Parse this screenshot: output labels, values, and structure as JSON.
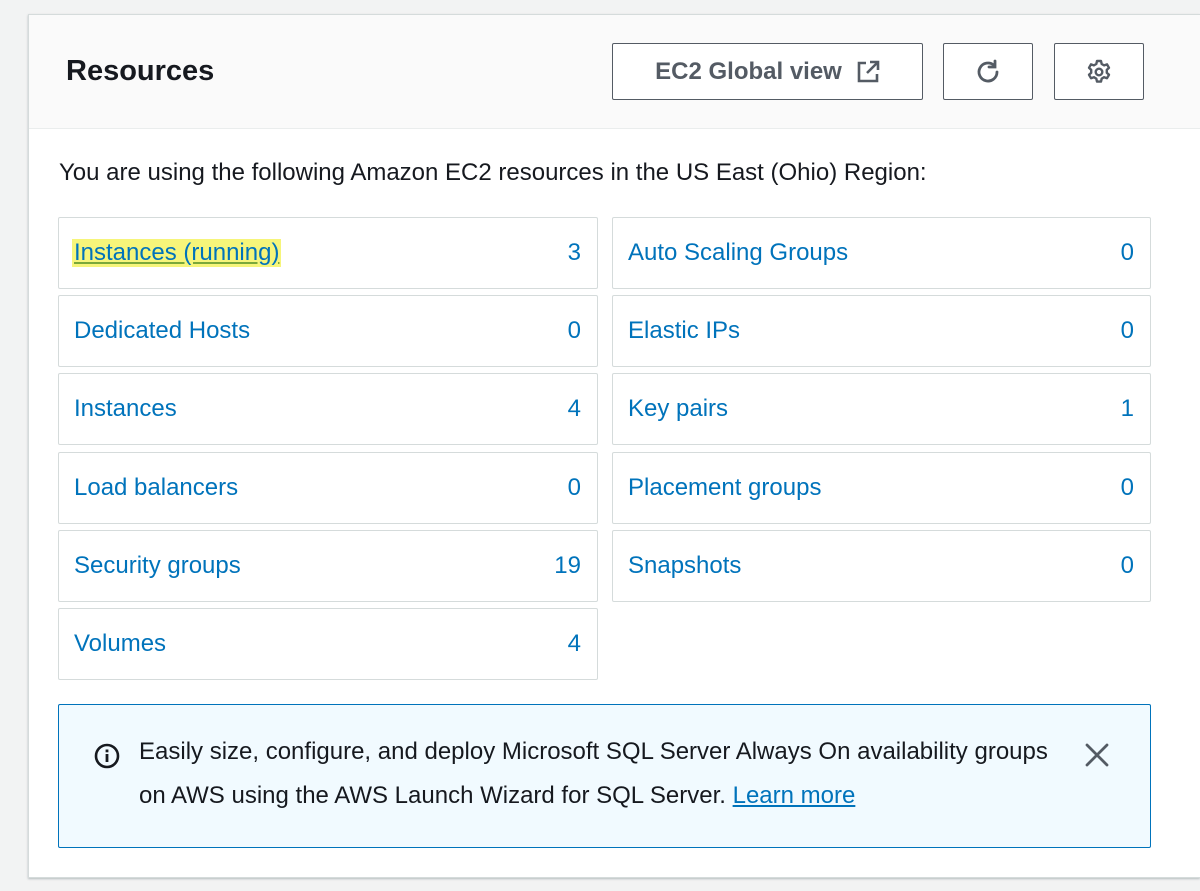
{
  "header": {
    "title": "Resources",
    "global_view_label": "EC2 Global view"
  },
  "intro_text": "You are using the following Amazon EC2 resources in the US East (Ohio) Region:",
  "resources_left": [
    {
      "label": "Instances (running)",
      "count": "3"
    },
    {
      "label": "Dedicated Hosts",
      "count": "0"
    },
    {
      "label": "Instances",
      "count": "4"
    },
    {
      "label": "Load balancers",
      "count": "0"
    },
    {
      "label": "Security groups",
      "count": "19"
    },
    {
      "label": "Volumes",
      "count": "4"
    }
  ],
  "resources_right": [
    {
      "label": "Auto Scaling Groups",
      "count": "0"
    },
    {
      "label": "Elastic IPs",
      "count": "0"
    },
    {
      "label": "Key pairs",
      "count": "1"
    },
    {
      "label": "Placement groups",
      "count": "0"
    },
    {
      "label": "Snapshots",
      "count": "0"
    }
  ],
  "alert": {
    "text": "Easily size, configure, and deploy Microsoft SQL Server Always On availability groups on AWS using the AWS Launch Wizard for SQL Server.",
    "link_label": "Learn more"
  },
  "icons": {
    "external": "external-link-icon",
    "refresh": "refresh-icon",
    "settings": "gear-icon",
    "info": "info-icon",
    "close": "close-icon"
  },
  "colors": {
    "link": "#0073bb",
    "highlight": "#f6f57a",
    "alert_bg": "#f1faff",
    "alert_border": "#0073bb"
  }
}
